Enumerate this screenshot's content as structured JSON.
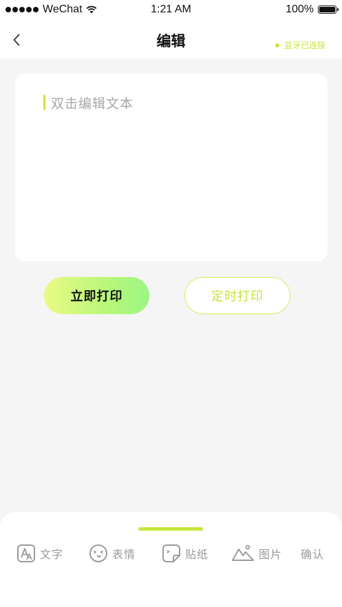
{
  "status_bar": {
    "carrier": "WeChat",
    "time": "1:21 AM",
    "battery": "100%"
  },
  "nav": {
    "title": "编辑",
    "bluetooth_status": "蓝牙已连接"
  },
  "editor": {
    "placeholder": "双击编辑文本"
  },
  "actions": {
    "print_now": "立即打印",
    "print_timed": "定时打印"
  },
  "toolbar": {
    "items": [
      {
        "label": "文字",
        "icon": "text-icon"
      },
      {
        "label": "表情",
        "icon": "emoji-icon"
      },
      {
        "label": "贴纸",
        "icon": "sticker-icon"
      },
      {
        "label": "图片",
        "icon": "image-icon"
      }
    ],
    "confirm": "确认"
  },
  "colors": {
    "accent": "#c6e83a",
    "background": "#f5f5f5",
    "muted_text": "#9a9a9a"
  }
}
